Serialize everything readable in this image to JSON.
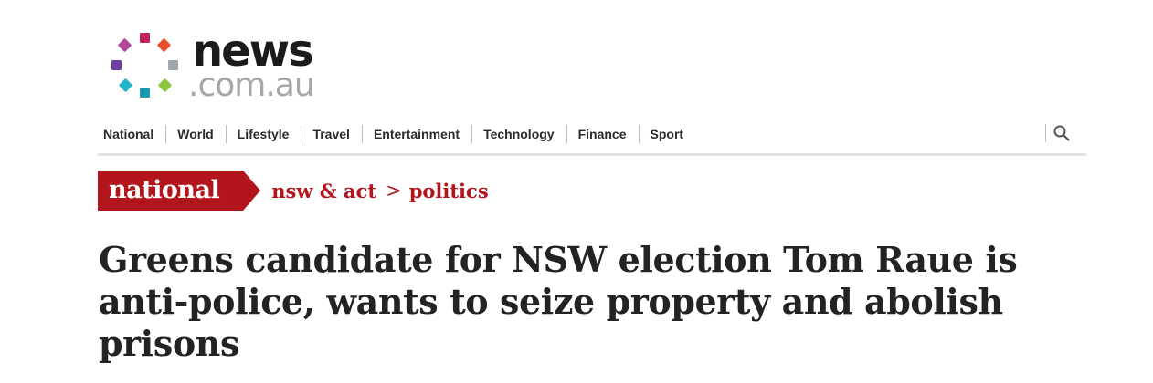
{
  "logo": {
    "word": "news",
    "domain": ".com.au",
    "colors": [
      "#c0235a",
      "#e8502e",
      "#f2a21e",
      "#8dc63f",
      "#26b5c8",
      "#6b3fa0",
      "#a7a7a7"
    ]
  },
  "nav": {
    "items": [
      "National",
      "World",
      "Lifestyle",
      "Travel",
      "Entertainment",
      "Technology",
      "Finance",
      "Sport"
    ],
    "search_icon": "search-icon"
  },
  "section": {
    "tag": "national",
    "breadcrumb": [
      "nsw & act",
      "politics"
    ],
    "separator": ">",
    "accent_color": "#b3151c"
  },
  "article": {
    "headline": "Greens candidate for NSW election Tom Raue is anti-police, wants to seize property and abolish prisons"
  }
}
